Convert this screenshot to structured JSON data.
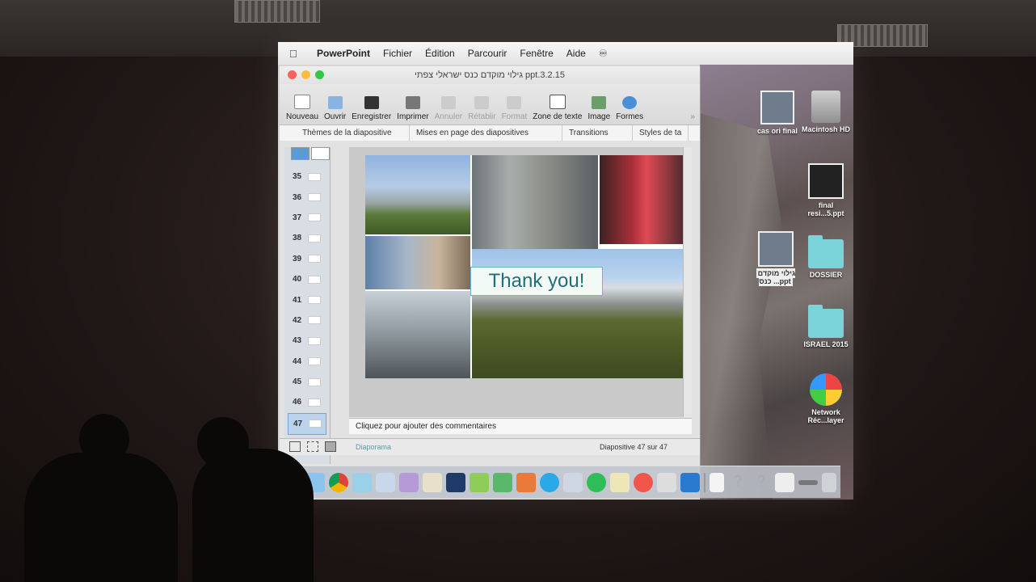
{
  "menubar": {
    "app": "PowerPoint",
    "items": [
      "Fichier",
      "Édition",
      "Parcourir",
      "Fenêtre",
      "Aide"
    ]
  },
  "window": {
    "title": "גילוי מוקדם כנס ישראלי צפתי ppt.3.2.15"
  },
  "toolbar": {
    "buttons": [
      {
        "label": "Nouveau",
        "icon": "new-doc-icon",
        "enabled": true
      },
      {
        "label": "Ouvrir",
        "icon": "open-folder-icon",
        "enabled": true
      },
      {
        "label": "Enregistrer",
        "icon": "save-icon",
        "enabled": true
      },
      {
        "label": "Imprimer",
        "icon": "print-icon",
        "enabled": true
      },
      {
        "label": "Annuler",
        "icon": "undo-icon",
        "enabled": false
      },
      {
        "label": "Rétablir",
        "icon": "redo-icon",
        "enabled": false
      },
      {
        "label": "Format",
        "icon": "format-icon",
        "enabled": false
      },
      {
        "label": "Zone de texte",
        "icon": "textbox-icon",
        "enabled": true
      },
      {
        "label": "Image",
        "icon": "image-icon",
        "enabled": true
      },
      {
        "label": "Formes",
        "icon": "shapes-icon",
        "enabled": true
      }
    ]
  },
  "ribbon": {
    "tabs": [
      "Thèmes de la diapositive",
      "Mises en page des diapositives",
      "Transitions",
      "Styles de ta"
    ]
  },
  "slides": {
    "numbers": [
      "35",
      "36",
      "37",
      "38",
      "39",
      "40",
      "41",
      "42",
      "43",
      "44",
      "45",
      "46",
      "47"
    ],
    "selected": "47"
  },
  "slide": {
    "caption": "Thank you!"
  },
  "notes": {
    "placeholder": "Cliquez pour ajouter des commentaires"
  },
  "status": {
    "view": "Diaporama",
    "position": "Diapositive 47 sur 47"
  },
  "desktop": {
    "icons": [
      "cas ori final",
      "Macintosh HD",
      "final resi...5.ppt",
      "גילוי מוקדם כנס ...ppt",
      "DOSSIER",
      "ISRAEL 2015",
      "Network Réc...layer"
    ]
  },
  "colors": {
    "accent": "#5b9bd5",
    "caption_text": "#1f6f7a",
    "folder": "#7ad3d6"
  }
}
